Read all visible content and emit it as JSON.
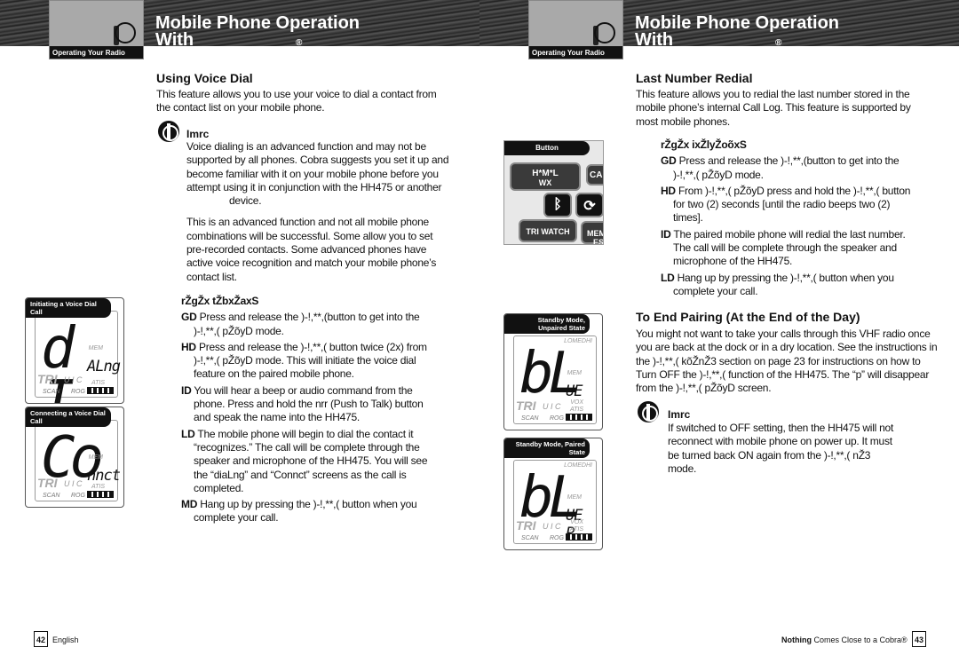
{
  "left": {
    "section_tab": "Operating Your Radio",
    "title_line1": "Mobile Phone Operation",
    "title_line2": "With",
    "reg": "®",
    "heading": "Using Voice Dial",
    "intro": "This feature allows you to use your voice to dial a contact from the contact list on your mobile phone.",
    "note_title": "Imrc",
    "note_p1a": "Voice dialing is an advanced function and may not be supported by all phones. Cobra suggests you set it up and become familiar with it on your mobile phone before you attempt using it in conjunction with the HH475 or another",
    "note_p1b": "device.",
    "note_p2": "This is an advanced function and not all mobile phone combinations will be successful. Some allow you to set pre-recorded contacts. Some advanced phones have active voice recognition and match your mobile phone’s contact list.",
    "steps_heading": "rŽgŽx tŽbxŽaxS",
    "steps": [
      {
        "n": "GD",
        "text": "Press and release the )-!,**,(button to get into the )-!,**,( pŽõyD mode."
      },
      {
        "n": "HD",
        "text": "Press and release the )-!,**,( button twice (2x) from )-!,**,( pŽõyD mode. This will initiate the voice dial feature on the paired mobile phone."
      },
      {
        "n": "ID",
        "text": "You will hear a beep or audio command from the phone. Press and hold the nrr (Push to Talk) button and speak the name into the HH475."
      },
      {
        "n": "LD",
        "text": "The mobile phone will begin to dial the contact it “recognizes.” The call will be complete through the speaker and microphone of the HH475. You will see the “diaLng” and “Connct” screens as the call is completed."
      },
      {
        "n": "MD",
        "text": "Hang up by pressing the )-!,**,( button when you complete your call."
      }
    ],
    "panels": [
      {
        "caption": "Initiating a Voice Dial Call",
        "big": "d I",
        "small": "ALng"
      },
      {
        "caption": "Connecting a Voice Dial Call",
        "big": "Co",
        "small": "nnct"
      }
    ],
    "page_number": "42",
    "footer": "English"
  },
  "right": {
    "section_tab": "Operating Your Radio",
    "title_line1": "Mobile Phone Operation",
    "title_line2": "With",
    "reg": "®",
    "heading": "Last Number Redial",
    "intro": "This feature allows you to redial the last number stored in the mobile phone’s internal Call Log. This feature is supported by most mobile phones.",
    "steps_heading": "rŽgŽx ixŽlyŽoõxS",
    "steps": [
      {
        "n": "GD",
        "text": "Press and release the )-!,**,(button to get into the )-!,**,( pŽõyD mode."
      },
      {
        "n": "HD",
        "text": "From )-!,**,( pŽõyD press and hold the )-!,**,( button for two (2) seconds [until the radio beeps two (2) times]."
      },
      {
        "n": "ID",
        "text": "The paired mobile phone will redial the last number. The call will be complete through the speaker and microphone of the HH475."
      },
      {
        "n": "LD",
        "text": "Hang up by pressing the )-!,**,( button when you complete your call."
      }
    ],
    "heading2": "To End Pairing (At the End of the Day)",
    "para2": "You might not want to take your calls through this VHF radio once you are back at the dock or in a dry location. See the instructions in the )-!,**,( kõŽnŽ3 section on page 23 for instructions on how to Turn OFF the )-!,**,( function of the HH475. The “p” will disappear from the )-!,**,( pŽõyD screen.",
    "note_title": "Imrc",
    "note_text": "If switched to OFF setting, then the HH475 will not reconnect with mobile phone on power up. It must be turned back ON again from the )-!,**,( nŽ3 mode.",
    "button_panel": {
      "caption": "Button",
      "keys": [
        "H*M*L",
        "WX",
        "CALL /",
        "TRI WATCH",
        "MEM / ES"
      ],
      "icons": [
        "bluetooth-icon",
        "refresh-icon"
      ]
    },
    "panels": [
      {
        "caption": "Standby Mode, Unpaired State",
        "big": "bL",
        "small": "UE"
      },
      {
        "caption": "Standby Mode, Paired State",
        "big": "bL",
        "small": "UE P"
      }
    ],
    "lcd_labels": {
      "tri": "TRI",
      "uic": "U I C",
      "a": "A",
      "vox": "VOX",
      "atis": "ATIS",
      "scan": "SCAN",
      "rog": "ROG",
      "mem": "MEM",
      "lomed": "LOMEDHI"
    },
    "footer_bold": "Nothing",
    "footer": "Comes Close to a Cobra®",
    "page_number": "43"
  }
}
